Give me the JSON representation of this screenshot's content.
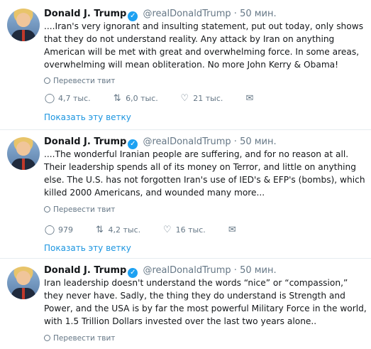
{
  "tweets": [
    {
      "name": "Donald J. Trump",
      "handle": "@realDonaldTrump",
      "dot": "·",
      "time": "50 мин.",
      "text": "....Iran's very ignorant and insulting statement, put out today, only shows that they do not understand reality. Any attack by Iran on anything American will be met with great and overwhelming force. In some areas, overwhelming will mean obliteration. No more John Kerry & Obama!",
      "translate": "Перевести твит",
      "replies": "4,7 тыс.",
      "retweets": "6,0 тыс.",
      "likes": "21 тыс.",
      "show_thread": "Показать эту ветку"
    },
    {
      "name": "Donald J. Trump",
      "handle": "@realDonaldTrump",
      "dot": "·",
      "time": "50 мин.",
      "text": "....The wonderful Iranian people are suffering, and for no reason at all. Their leadership spends all of its money on Terror, and little on anything else. The U.S. has not forgotten Iran's use of IED's & EFP's (bombs), which killed 2000 Americans, and wounded many more...",
      "translate": "Перевести твит",
      "replies": "979",
      "retweets": "4,2 тыс.",
      "likes": "16 тыс.",
      "show_thread": "Показать эту ветку"
    },
    {
      "name": "Donald J. Trump",
      "handle": "@realDonaldTrump",
      "dot": "·",
      "time": "50 мин.",
      "text": "Iran leadership doesn't understand the words “nice” or “compassion,” they never have. Sadly, the thing they do understand is Strength and Power, and the USA is by far the most powerful Military Force in the world, with 1.5 Trillion Dollars invested over the last two years alone..",
      "translate": "Перевести твит"
    }
  ],
  "colors": {
    "accent": "#1b95e0",
    "verified": "#1da1f2",
    "muted": "#657786",
    "separator": "#e6ecf0"
  },
  "icons": {
    "reply": "reply-icon",
    "retweet": "retweet-icon",
    "like": "heart-icon",
    "message": "mail-icon",
    "translate": "globe-icon",
    "verified": "verified-badge-icon"
  }
}
